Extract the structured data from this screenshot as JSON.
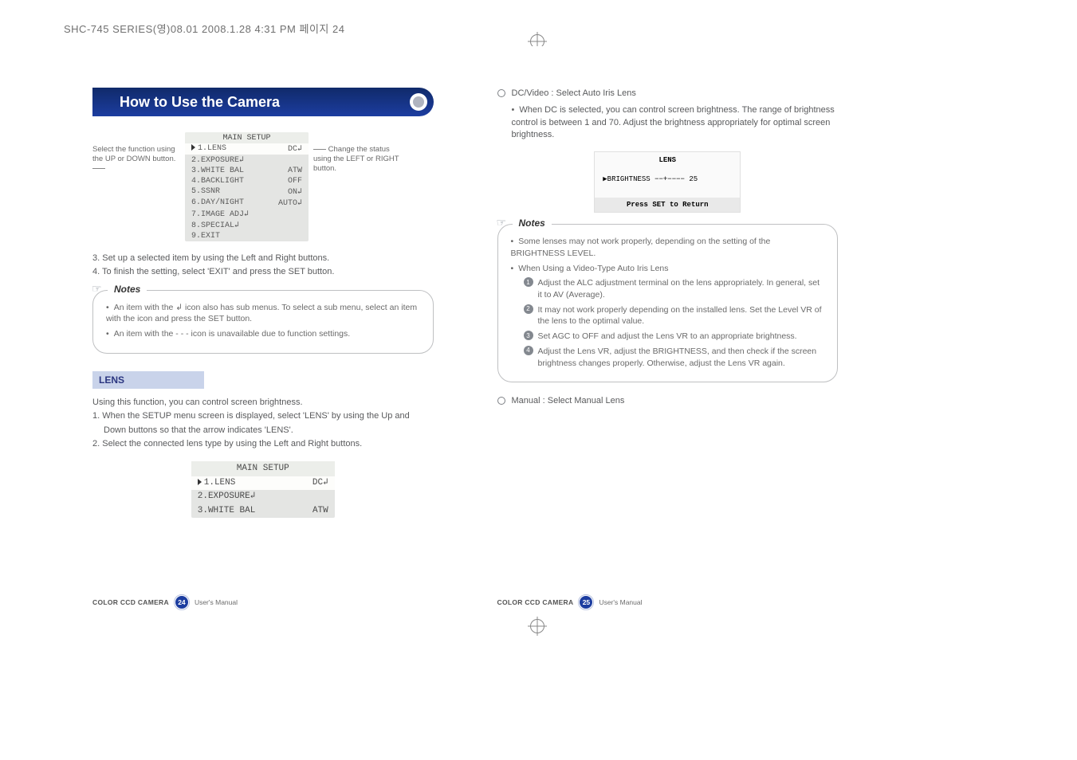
{
  "doc_info": "SHC-745 SERIES(영)08.01  2008.1.28 4:31 PM  페이지 24",
  "left_page": {
    "title": "How to Use the Camera",
    "hint_left": "Select the function using the UP or DOWN button.",
    "hint_right": "Change the status using the LEFT or RIGHT button.",
    "menu_title": "MAIN SETUP",
    "menu_items": [
      {
        "label": "1.LENS",
        "value": "DC↲",
        "selected": true,
        "caret": true
      },
      {
        "label": "2.EXPOSURE↲",
        "value": "",
        "selected": false
      },
      {
        "label": "3.WHITE BAL",
        "value": "ATW",
        "selected": false
      },
      {
        "label": "4.BACKLIGHT",
        "value": "OFF",
        "selected": false
      },
      {
        "label": "5.SSNR",
        "value": "ON↲",
        "selected": false
      },
      {
        "label": "6.DAY/NIGHT",
        "value": "AUTO↲",
        "selected": false
      },
      {
        "label": "7.IMAGE ADJ↲",
        "value": "",
        "selected": false
      },
      {
        "label": "8.SPECIAL↲",
        "value": "",
        "selected": false
      },
      {
        "label": "9.EXIT",
        "value": "",
        "selected": false
      }
    ],
    "step3": "3. Set up a selected item by using the Left and Right buttons.",
    "step4": "4. To finish the setting, select 'EXIT' and press the SET button.",
    "notes_label": "Notes",
    "note1": "An item with the ↲ icon also has sub menus. To select a sub menu, select an item with the icon and press the SET button.",
    "note2": "An item with the - - - icon is unavailable due to function settings.",
    "lens_heading": "LENS",
    "lens_intro": "Using this function, you can control screen brightness.",
    "lens_step1a": "1. When the SETUP menu screen is displayed, select 'LENS' by using the Up and",
    "lens_step1b": "Down buttons so that the arrow indicates 'LENS'.",
    "lens_step2": "2. Select the connected lens type by using the Left and Right buttons.",
    "mini_menu_title": "MAIN SETUP",
    "mini_menu_items": [
      {
        "label": "1.LENS",
        "value": "DC↲",
        "selected": true,
        "caret": true
      },
      {
        "label": "2.EXPOSURE↲",
        "value": ""
      },
      {
        "label": "3.WHITE BAL",
        "value": "ATW"
      }
    ],
    "footer_strong": "COLOR CCD CAMERA",
    "footer_num": "24",
    "footer_text": "User's Manual"
  },
  "right_page": {
    "dc_title": "DC/Video : Select Auto Iris Lens",
    "dc_bullet": "When DC is selected, you can control screen brightness. The range of brightness control is between 1 and 70. Adjust the brightness appropriately for optimal screen brightness.",
    "lens_screen_title": "LENS",
    "lens_screen_brightness_label": "▶BRIGHTNESS",
    "lens_screen_brightness_bar": "−−+−−−−",
    "lens_screen_brightness_value": "25",
    "lens_screen_return": "Press SET to Return",
    "notes_label": "Notes",
    "note1": "Some lenses may not work properly, depending on the setting of the BRIGHTNESS LEVEL.",
    "note2": "When Using a Video-Type Auto Iris Lens",
    "sub1": "Adjust the ALC adjustment terminal on the lens appropriately. In general, set it to AV (Average).",
    "sub2": "It may not work properly depending on the installed lens. Set the Level VR of the lens to the optimal value.",
    "sub3": "Set AGC to OFF and adjust the Lens VR to an appropriate brightness.",
    "sub4": "Adjust the Lens VR, adjust the BRIGHTNESS, and then check if the screen brightness changes properly. Otherwise, adjust the Lens VR again.",
    "manual_title": "Manual : Select Manual Lens",
    "footer_strong": "COLOR CCD CAMERA",
    "footer_num": "25",
    "footer_text": "User's Manual"
  }
}
